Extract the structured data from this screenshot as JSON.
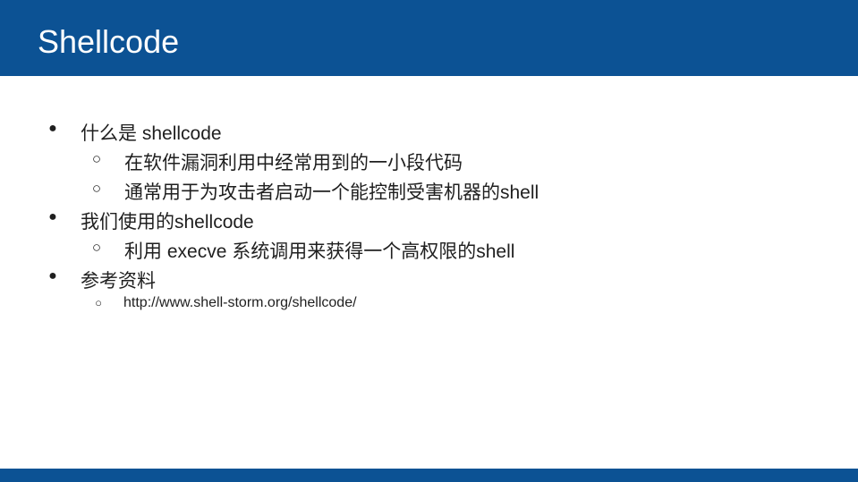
{
  "slide": {
    "title": "Shellcode",
    "bullet_glyphs": {
      "level1": "●",
      "level2": "○"
    },
    "items": [
      {
        "level": 1,
        "text": "什么是 shellcode"
      },
      {
        "level": 2,
        "text": "在软件漏洞利用中经常用到的一小段代码"
      },
      {
        "level": 2,
        "text": "通常用于为攻击者启动一个能控制受害机器的shell"
      },
      {
        "level": 1,
        "text": "我们使用的shellcode"
      },
      {
        "level": 2,
        "text": "利用 execve 系统调用来获得一个高权限的shell"
      },
      {
        "level": 1,
        "text": "参考资料"
      },
      {
        "level": 2,
        "text": "http://www.shell-storm.org/shellcode/"
      }
    ]
  },
  "colors": {
    "header": "#0c5294",
    "title_text": "#ffffff",
    "body_text": "#1f1f1f"
  }
}
